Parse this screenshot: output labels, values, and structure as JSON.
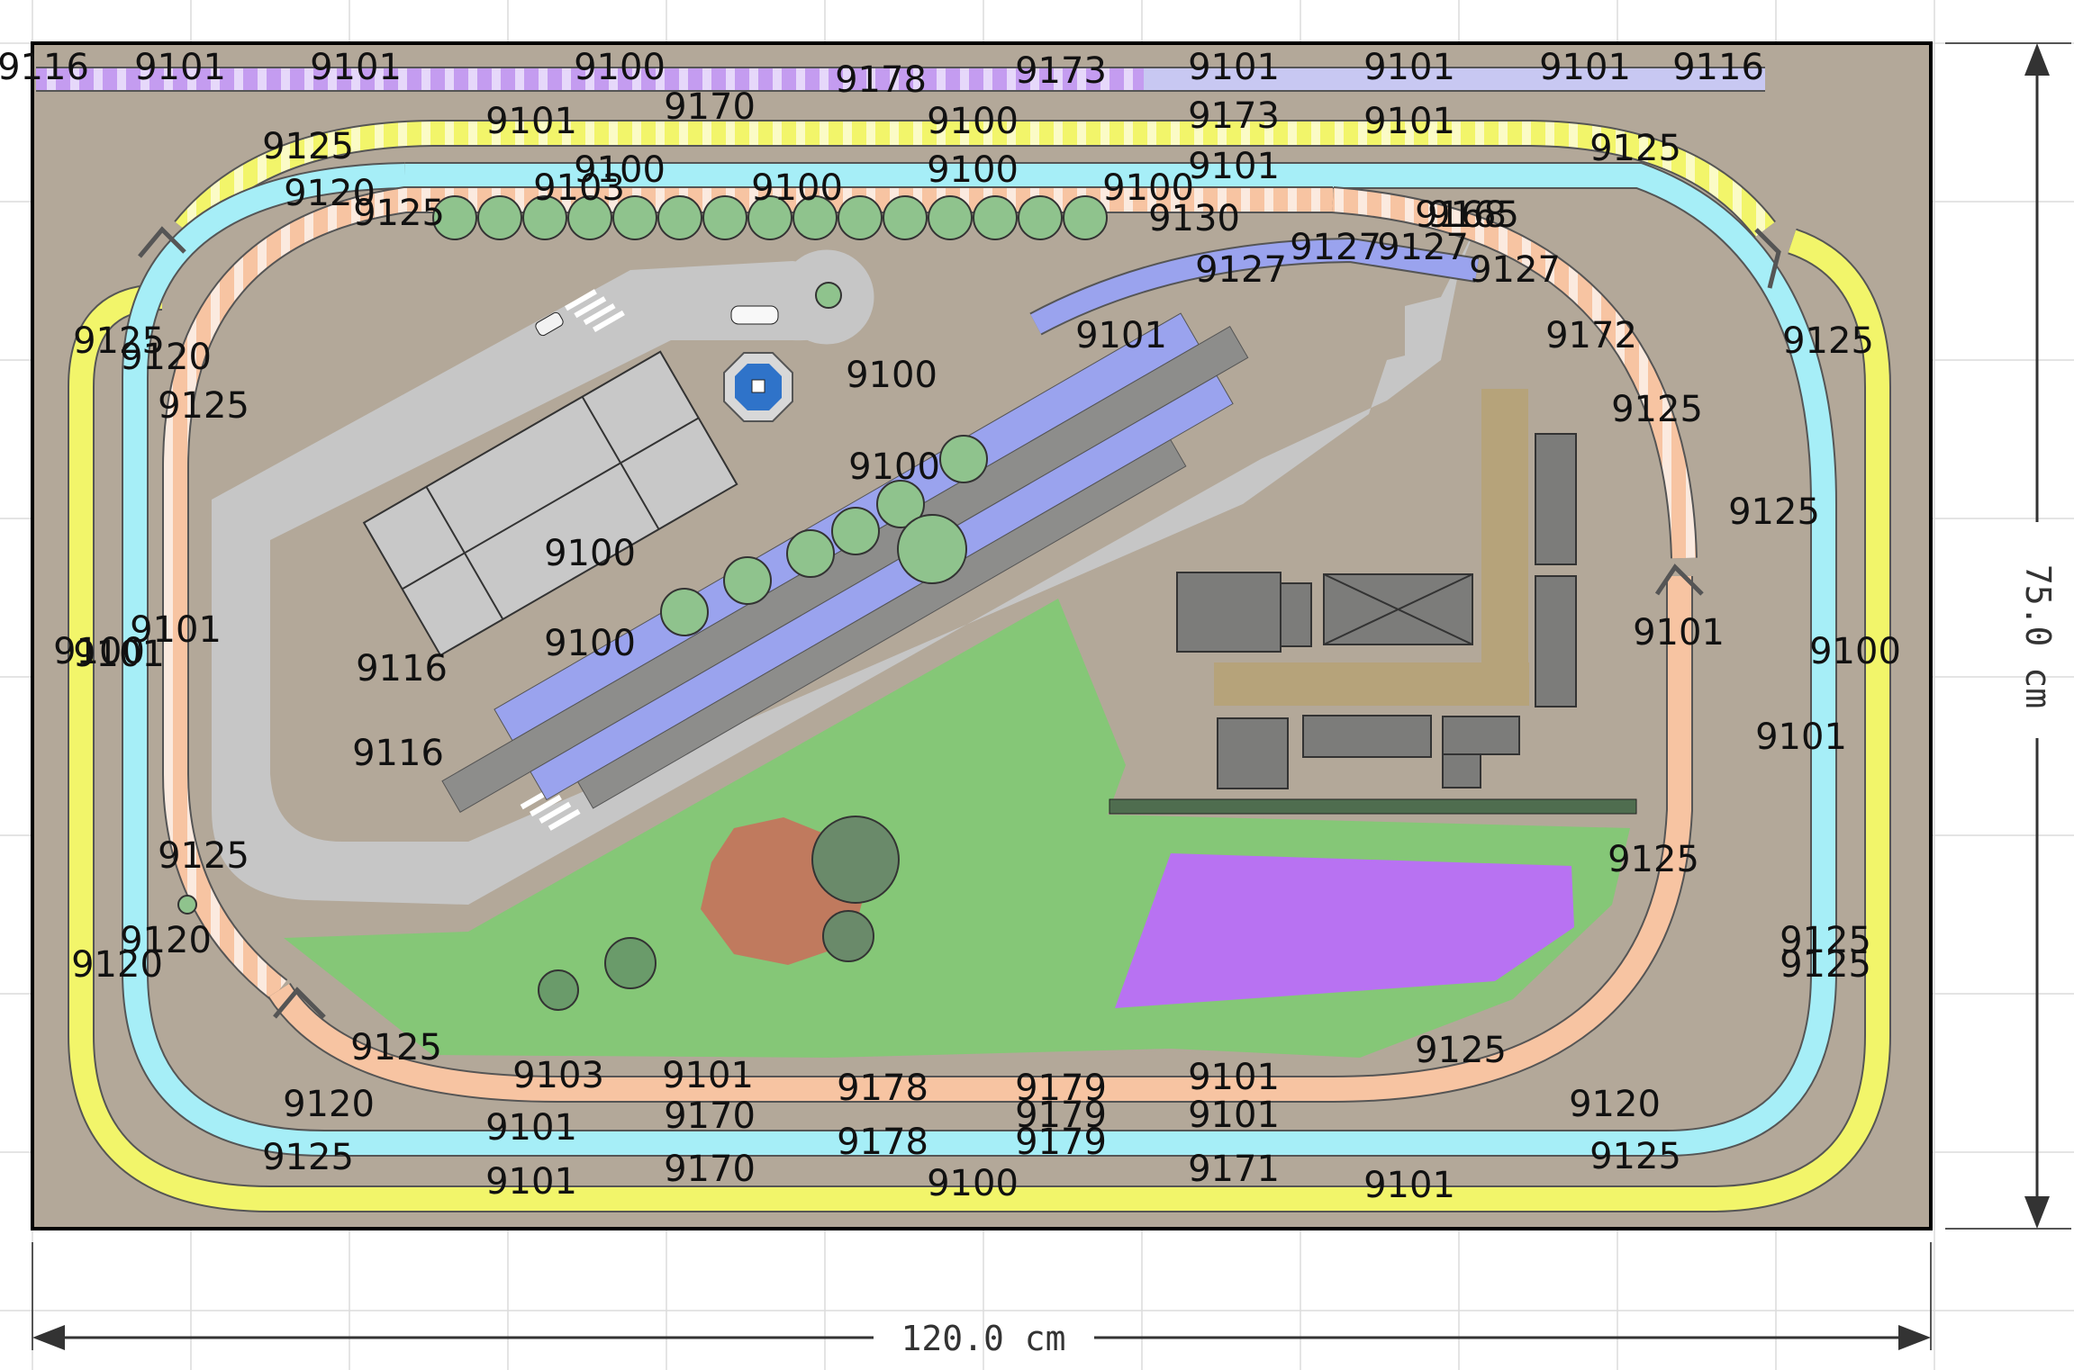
{
  "layout": {
    "title": "",
    "width_label": "120.0 cm",
    "height_label": "75.0 cm"
  },
  "colors": {
    "board": "#b3a899",
    "grid": "#d7d7d7",
    "track_yellow": "#f2f56a",
    "track_cyan": "#a6eef7",
    "track_salmon": "#f7c4a2",
    "track_purple": "#c49cf0",
    "track_blue": "#9aa3ee",
    "track_lilac": "#c8c8f2",
    "road": "#c6c6c6",
    "grass": "#85c777",
    "pond": "#b872f2",
    "clay": "#c07a5e",
    "platform": "#8d8d8b",
    "roof": "#7c7c7a",
    "dirt": "#b6a37a"
  },
  "icons": [
    "tree-icon",
    "car-icon",
    "fountain-icon",
    "bench-icon",
    "buffer-stop-icon"
  ],
  "track_labels": [
    "9116",
    "9101",
    "9101",
    "9100",
    "9178",
    "9173",
    "9101",
    "9101",
    "9101",
    "9116",
    "9170",
    "9101",
    "9100",
    "9173",
    "9101",
    "9125",
    "9125",
    "9100",
    "9100",
    "9101",
    "9120",
    "9103",
    "9100",
    "9100",
    "9125",
    "9130",
    "9168",
    "9165",
    "9127",
    "9127",
    "9127",
    "9127",
    "9101",
    "9172",
    "9125",
    "9120",
    "9125",
    "9125",
    "9100",
    "9125",
    "9100",
    "9125",
    "9100",
    "9100",
    "9101",
    "9116",
    "9100",
    "9116",
    "9101",
    "9100",
    "9101",
    "9101",
    "9125",
    "9125",
    "9120",
    "9125",
    "9120",
    "9125",
    "9125",
    "9103",
    "9101",
    "9178",
    "9179",
    "9101",
    "9125",
    "9120",
    "9101",
    "9170",
    "9179",
    "9101",
    "9120",
    "9125",
    "9101",
    "9170",
    "9178",
    "9179",
    "9100",
    "9171",
    "9101",
    "9125"
  ]
}
